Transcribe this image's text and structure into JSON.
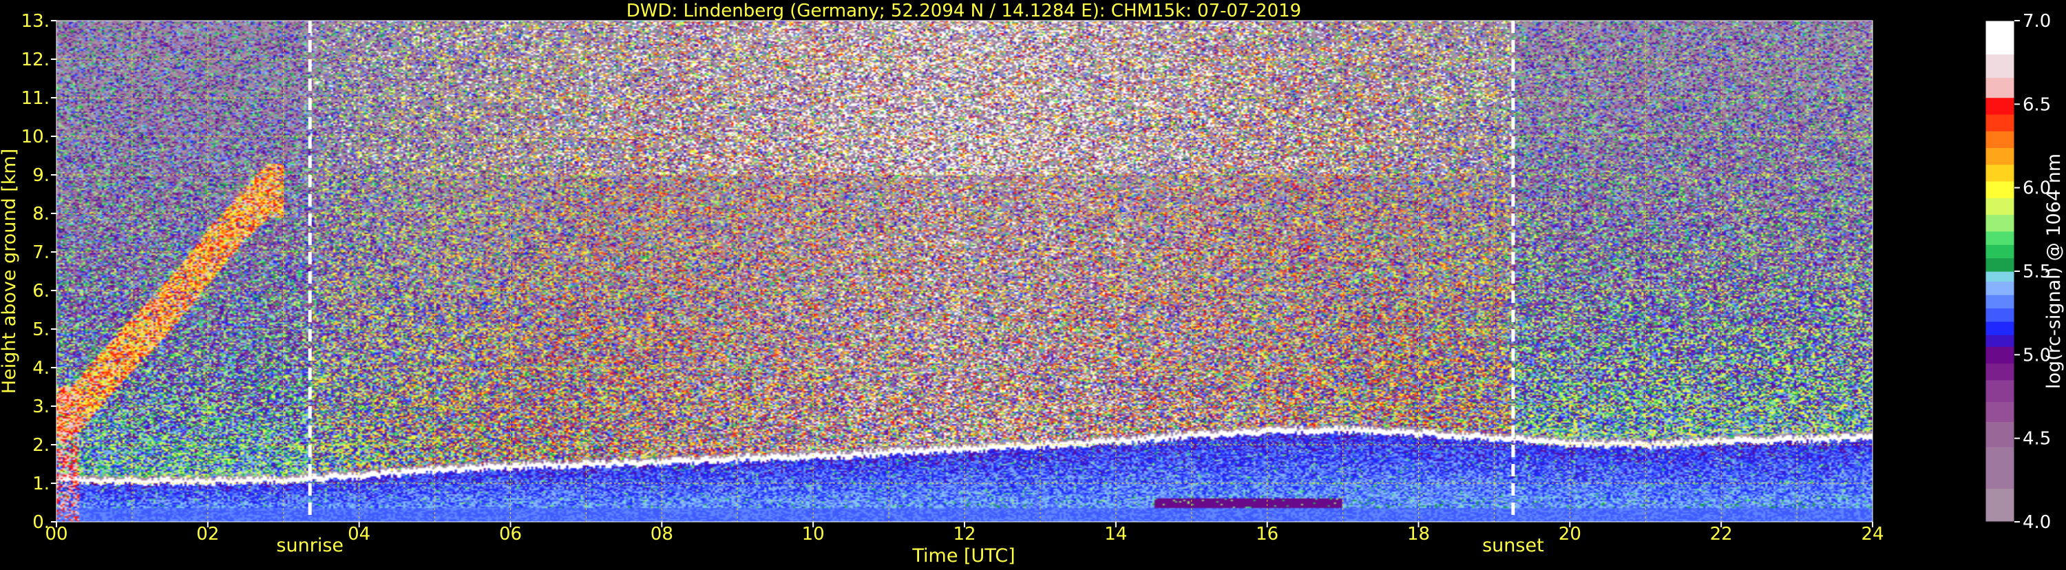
{
  "chart_data": {
    "type": "heatmap",
    "title": "DWD: Lindenberg (Germany; 52.2094 N / 14.1284 E):    CHM15k: 07-07-2019",
    "xlabel": "Time [UTC]",
    "ylabel": "Height above ground [km]",
    "xlim": [
      0,
      24
    ],
    "ylim": [
      0,
      13
    ],
    "x_ticks": [
      "00",
      "02",
      "04",
      "06",
      "08",
      "10",
      "12",
      "14",
      "16",
      "18",
      "20",
      "22",
      "24"
    ],
    "y_ticks": [
      "0.",
      "1.",
      "2.",
      "3.",
      "4.",
      "5.",
      "6.",
      "7.",
      "8.",
      "9.",
      "10.",
      "11.",
      "12.",
      "13."
    ],
    "grid": true,
    "markers": [
      {
        "label": "sunrise",
        "x": 3.35
      },
      {
        "label": "sunset",
        "x": 19.25
      }
    ],
    "colorbar": {
      "label": "log(rc-signal) @ 1064 nm",
      "range": [
        4.0,
        7.0
      ],
      "ticks": [
        "4.0",
        "4.5",
        "5.0",
        "5.5",
        "6.0",
        "6.5",
        "7.0"
      ],
      "bands": [
        {
          "from": 4.0,
          "to": 4.2,
          "color": "#a88fa6"
        },
        {
          "from": 4.2,
          "to": 4.45,
          "color": "#9e789e"
        },
        {
          "from": 4.45,
          "to": 4.6,
          "color": "#9a6799"
        },
        {
          "from": 4.6,
          "to": 4.72,
          "color": "#944f96"
        },
        {
          "from": 4.72,
          "to": 4.85,
          "color": "#8a3d92"
        },
        {
          "from": 4.85,
          "to": 4.95,
          "color": "#7a1f8c"
        },
        {
          "from": 4.95,
          "to": 5.05,
          "color": "#6a0a8a"
        },
        {
          "from": 5.05,
          "to": 5.12,
          "color": "#3b14c8"
        },
        {
          "from": 5.12,
          "to": 5.2,
          "color": "#1e28ff"
        },
        {
          "from": 5.2,
          "to": 5.28,
          "color": "#3f5bff"
        },
        {
          "from": 5.28,
          "to": 5.36,
          "color": "#5f86ff"
        },
        {
          "from": 5.36,
          "to": 5.44,
          "color": "#86b2ff"
        },
        {
          "from": 5.44,
          "to": 5.5,
          "color": "#7fd4e6"
        },
        {
          "from": 5.5,
          "to": 5.58,
          "color": "#1aa04a"
        },
        {
          "from": 5.58,
          "to": 5.66,
          "color": "#28c25a"
        },
        {
          "from": 5.66,
          "to": 5.74,
          "color": "#4fe070"
        },
        {
          "from": 5.74,
          "to": 5.84,
          "color": "#9cf075"
        },
        {
          "from": 5.84,
          "to": 5.94,
          "color": "#d8f860"
        },
        {
          "from": 5.94,
          "to": 6.04,
          "color": "#ffff33"
        },
        {
          "from": 6.04,
          "to": 6.14,
          "color": "#ffd21e"
        },
        {
          "from": 6.14,
          "to": 6.24,
          "color": "#ffa51a"
        },
        {
          "from": 6.24,
          "to": 6.34,
          "color": "#ff7a14"
        },
        {
          "from": 6.34,
          "to": 6.44,
          "color": "#ff3c10"
        },
        {
          "from": 6.44,
          "to": 6.54,
          "color": "#ff1010"
        },
        {
          "from": 6.54,
          "to": 6.66,
          "color": "#f4bcbc"
        },
        {
          "from": 6.66,
          "to": 6.8,
          "color": "#f0dbe0"
        },
        {
          "from": 6.8,
          "to": 7.0,
          "color": "#ffffff"
        }
      ]
    },
    "cloud_base_km": [
      [
        0.0,
        1.1
      ],
      [
        1.0,
        1.05
      ],
      [
        2.0,
        1.05
      ],
      [
        3.0,
        1.1
      ],
      [
        4.0,
        1.2
      ],
      [
        5.0,
        1.35
      ],
      [
        6.0,
        1.45
      ],
      [
        7.0,
        1.5
      ],
      [
        8.0,
        1.55
      ],
      [
        9.0,
        1.65
      ],
      [
        10.0,
        1.7
      ],
      [
        11.0,
        1.8
      ],
      [
        12.0,
        1.9
      ],
      [
        13.0,
        2.0
      ],
      [
        14.0,
        2.1
      ],
      [
        15.0,
        2.25
      ],
      [
        16.0,
        2.35
      ],
      [
        17.0,
        2.4
      ],
      [
        18.0,
        2.3
      ],
      [
        19.0,
        2.2
      ],
      [
        20.0,
        2.05
      ],
      [
        21.0,
        2.0
      ],
      [
        22.0,
        2.1
      ],
      [
        23.0,
        2.15
      ],
      [
        24.0,
        2.2
      ]
    ],
    "aerosol_top_km": [
      [
        0.0,
        1.15
      ],
      [
        2.0,
        1.1
      ],
      [
        4.0,
        1.25
      ],
      [
        6.0,
        1.45
      ],
      [
        8.0,
        1.55
      ],
      [
        10.0,
        1.75
      ],
      [
        12.0,
        1.95
      ],
      [
        14.0,
        2.15
      ],
      [
        16.0,
        2.45
      ],
      [
        18.0,
        2.4
      ],
      [
        20.0,
        2.1
      ],
      [
        22.0,
        2.15
      ],
      [
        24.0,
        2.2
      ]
    ],
    "ice_cloud": [
      [
        0.2,
        3.0
      ],
      [
        0.5,
        3.7
      ],
      [
        0.9,
        4.6
      ],
      [
        1.3,
        5.4
      ],
      [
        1.7,
        6.3
      ],
      [
        2.1,
        7.3
      ],
      [
        2.5,
        8.2
      ],
      [
        2.8,
        8.8
      ]
    ]
  }
}
